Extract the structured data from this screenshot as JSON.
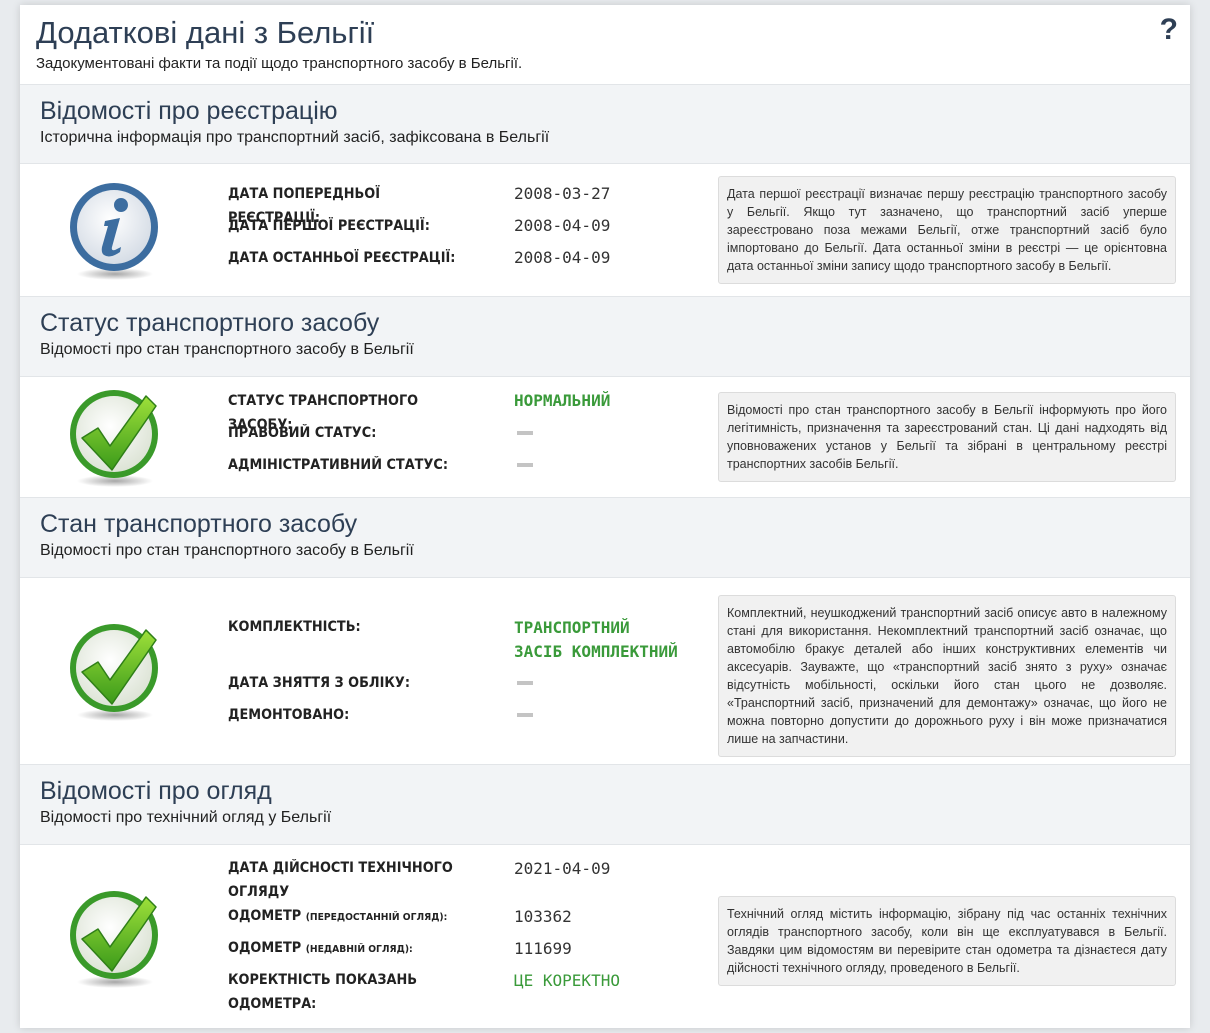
{
  "header": {
    "title": "Додаткові дані з Бельгії",
    "subtitle": "Задокументовані факти та події щодо транспортного засобу в Бельгії.",
    "help_icon": "question-mark-icon"
  },
  "colors": {
    "title": "#2e3f55",
    "ok_green": "#3a9a3a",
    "dash_gray": "#c4c4c4"
  },
  "registration": {
    "title": "Відомості про реєстрацію",
    "subtitle": "Історична інформація про транспортний засіб, зафіксована в Бельгії",
    "icon": "info-icon",
    "rows": [
      {
        "label": "ДАТА ПОПЕРЕДНЬОЇ РЕЄСТРАЦІЇ:",
        "value": "2008-03-27"
      },
      {
        "label": "ДАТА ПЕРШОЇ РЕЄСТРАЦІЇ:",
        "value": "2008-04-09"
      },
      {
        "label": "ДАТА ОСТАННЬОЇ РЕЄСТРАЦІЇ:",
        "value": "2008-04-09"
      }
    ],
    "note": "Дата першої реєстрації визначає першу реєстрацію транспортного засобу у Бельгії. Якщо тут зазначено, що транспортний засіб уперше зареєстровано поза межами Бельгії, отже транспортний засіб було імпортовано до Бельгії. Дата останньої зміни в реєстрі — це орієнтовна дата останньої зміни запису щодо транспортного засобу в Бельгії."
  },
  "status": {
    "title": "Статус транспортного засобу",
    "subtitle": "Відомості про стан транспортного засобу в Бельгії",
    "icon": "checkmark-icon",
    "rows": [
      {
        "label": "СТАТУС ТРАНСПОРТНОГО ЗАСОБУ:",
        "value": "НОРМАЛЬНИЙ"
      },
      {
        "label": "ПРАВОВИЙ СТАТУС:",
        "value": ""
      },
      {
        "label": "АДМІНІСТРАТИВНИЙ СТАТУС:",
        "value": ""
      }
    ],
    "note": "Відомості про стан транспортного засобу в Бельгії інформують про його легітимність, призначення та зареєстрований стан. Ці дані надходять від уповноважених установ у Бельгії та зібрані в центральному реєстрі транспортних засобів Бельгії."
  },
  "condition": {
    "title": "Стан транспортного засобу",
    "subtitle": "Відомості про стан транспортного засобу в Бельгії",
    "icon": "checkmark-icon",
    "rows": [
      {
        "label": "КОМПЛЕКТНІСТЬ:",
        "value_line1": "ТРАНСПОРТНИЙ",
        "value_line2": "ЗАСІБ КОМПЛЕКТНИЙ"
      },
      {
        "label": "ДАТА ЗНЯТТЯ З ОБЛІКУ:",
        "value": ""
      },
      {
        "label": "ДЕМОНТОВАНО:",
        "value": ""
      }
    ],
    "note": "Комплектний, неушкоджений транспортний засіб описує авто в належному стані для використання. Некомплектний транспортний засіб означає, що автомобілю бракує деталей або інших конструктивних елементів чи аксесуарів. Зауважте, що «транспортний засіб знято з руху» означає відсутність мобільності, оскільки його стан цього не дозволяє. «Транспортний засіб, призначений для демонтажу» означає, що його не можна повторно допустити до дорожнього руху і він може призначатися лише на запчастини."
  },
  "inspection": {
    "title": "Відомості про огляд",
    "subtitle": "Відомості про технічний огляд у Бельгії",
    "icon": "checkmark-icon",
    "rows": [
      {
        "label_line1": "ДАТА ДІЙСНОСТІ ТЕХНІЧНОГО",
        "label_line2": "ОГЛЯДУ",
        "value": "2021-04-09"
      },
      {
        "label": "ОДОМЕТР",
        "label_small": "(ПЕРЕДОСТАННІЙ ОГЛЯД):",
        "value": "103362"
      },
      {
        "label": "ОДОМЕТР",
        "label_small": "(НЕДАВНІЙ ОГЛЯД):",
        "value": "111699"
      },
      {
        "label_line1": "КОРЕКТНІСТЬ ПОКАЗАНЬ",
        "label_line2": "ОДОМЕТРА:",
        "value": "ЦЕ КОРЕКТНО"
      }
    ],
    "note": "Технічний огляд містить інформацію, зібрану під час останніх технічних оглядів транспортного засобу, коли він ще експлуатувався в Бельгії. Завдяки цим відомостям ви перевірите стан одометра та дізнаєтеся дату дійсності технічного огляду, проведеного в Бельгії."
  }
}
